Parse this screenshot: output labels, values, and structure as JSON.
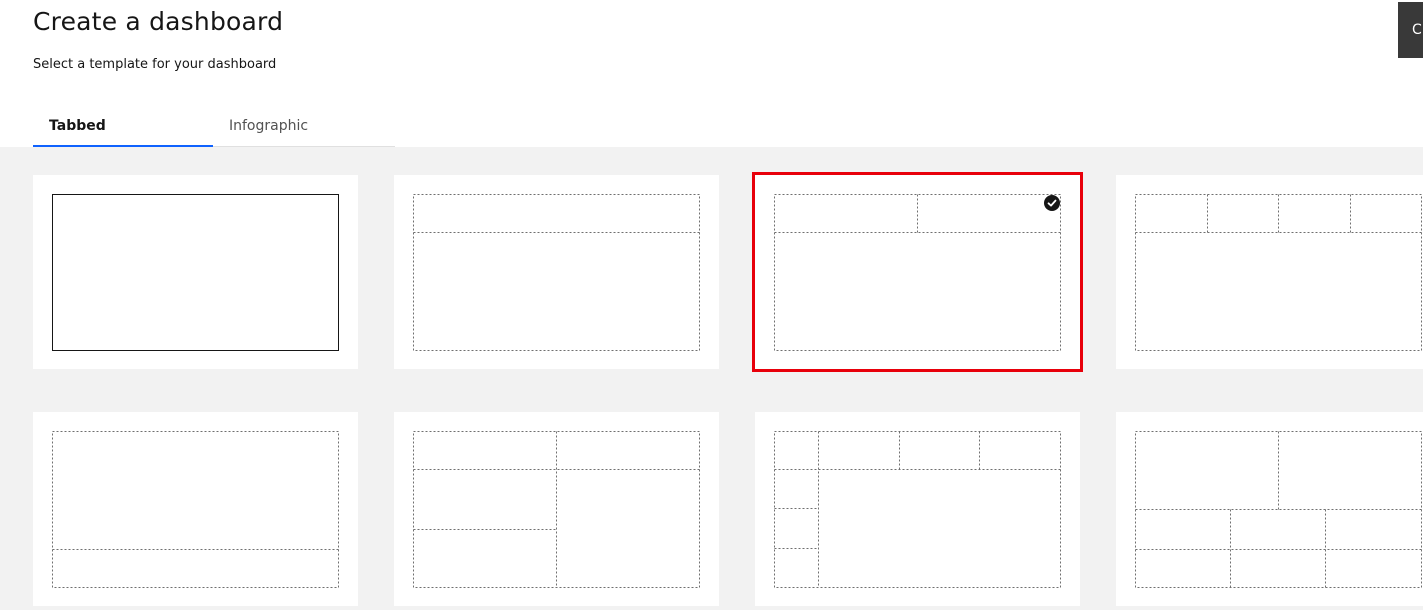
{
  "header": {
    "title": "Create a dashboard",
    "subtitle": "Select a template for your dashboard",
    "action_label": "C"
  },
  "tabs": [
    {
      "label": "Tabbed",
      "active": true
    },
    {
      "label": "Infographic",
      "active": false
    }
  ],
  "templates": {
    "selected_index": 2,
    "items": [
      {
        "name": "single-panel"
      },
      {
        "name": "header-and-body"
      },
      {
        "name": "two-header-panels-and-body"
      },
      {
        "name": "four-header-panels-and-body"
      },
      {
        "name": "body-and-footer"
      },
      {
        "name": "split-left-stack-right-panel"
      },
      {
        "name": "left-column-three-top-panels"
      },
      {
        "name": "quadrant-grid"
      }
    ]
  },
  "colors": {
    "accent": "#0f62fe",
    "selection": "#e8000b",
    "gallery_background": "#f2f2f2",
    "primary_button": "#393939"
  }
}
